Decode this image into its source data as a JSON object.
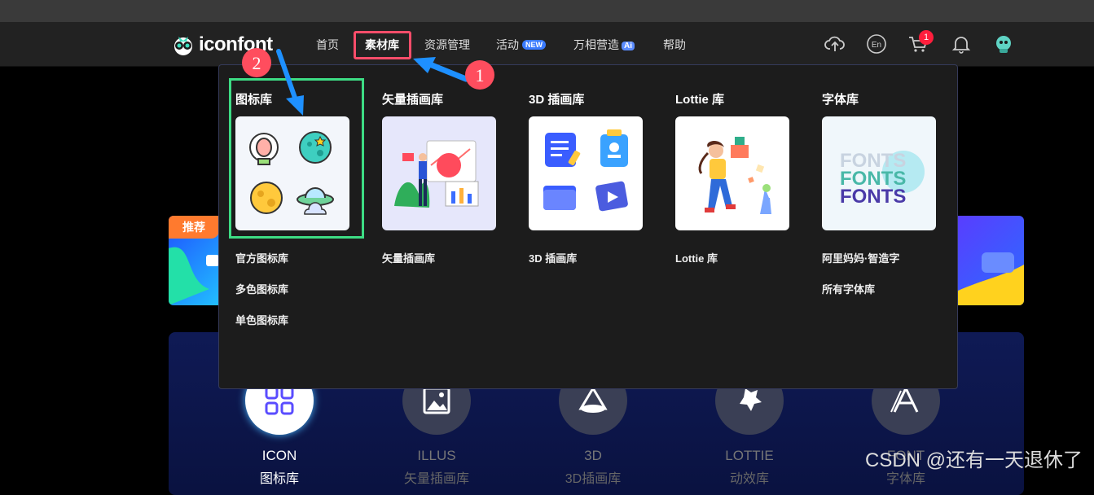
{
  "logo": {
    "text": "iconfont"
  },
  "nav": {
    "items": [
      {
        "label": "首页"
      },
      {
        "label": "素材库"
      },
      {
        "label": "资源管理"
      },
      {
        "label": "活动",
        "badge": "NEW"
      },
      {
        "label": "万相营造",
        "badge": "Ai"
      },
      {
        "label": "帮助"
      }
    ],
    "cart_count": "1",
    "icons": [
      "upload-icon",
      "language-icon",
      "cart-icon",
      "bell-icon",
      "avatar"
    ]
  },
  "dropdown": {
    "columns": [
      {
        "title": "图标库",
        "links": [
          "官方图标库",
          "多色图标库",
          "单色图标库"
        ]
      },
      {
        "title": "矢量插画库",
        "links": [
          "矢量插画库"
        ]
      },
      {
        "title": "3D 插画库",
        "links": [
          "3D 插画库"
        ]
      },
      {
        "title": "Lottie 库",
        "links": [
          "Lottie 库"
        ]
      },
      {
        "title": "字体库",
        "links": [
          "阿里妈妈·智造字",
          "所有字体库"
        ],
        "preview_text": [
          "FONTS",
          "FONTS",
          "FONTS"
        ]
      }
    ]
  },
  "annotations": {
    "step1": "1",
    "step2": "2"
  },
  "background": {
    "recommend_tag": "推荐",
    "categories": [
      {
        "title": "ICON",
        "subtitle": "图标库"
      },
      {
        "title": "ILLUS",
        "subtitle": "矢量插画库"
      },
      {
        "title": "3D",
        "subtitle": "3D插画库"
      },
      {
        "title": "LOTTIE",
        "subtitle": "动效库"
      },
      {
        "title": "FONT",
        "subtitle": "字体库"
      }
    ]
  },
  "watermark": "CSDN @还有一天退休了",
  "colors": {
    "nav_bg": "#222222",
    "dropdown_bg": "#1c1c1c",
    "highlight_red": "#ff4d6a",
    "highlight_green": "#3ddc84",
    "arrow_blue": "#1e90ff",
    "badge_new": "#3a7bff"
  }
}
